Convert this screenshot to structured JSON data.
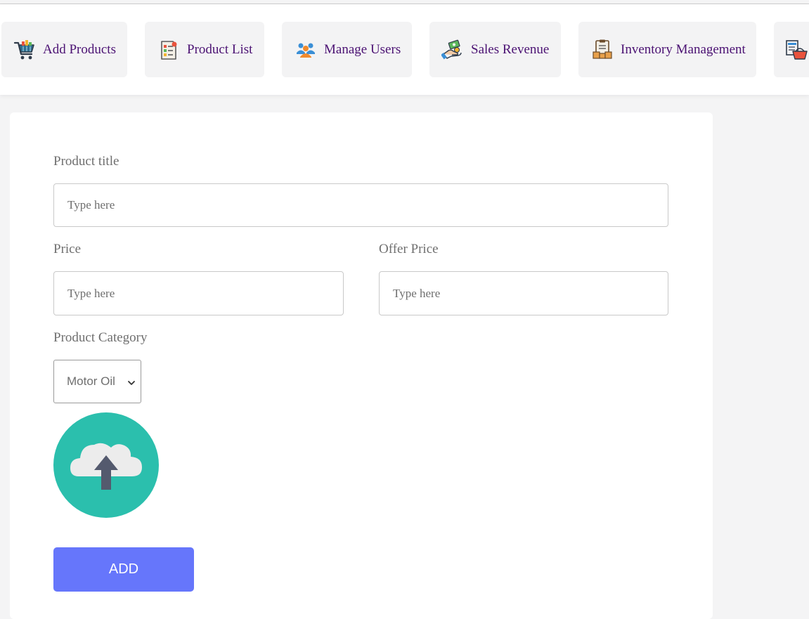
{
  "nav": {
    "items": [
      {
        "label": "Add Products",
        "icon": "shopping-cart-icon"
      },
      {
        "label": "Product List",
        "icon": "checklist-icon"
      },
      {
        "label": "Manage Users",
        "icon": "users-icon"
      },
      {
        "label": "Sales Revenue",
        "icon": "money-hand-icon"
      },
      {
        "label": "Inventory Management",
        "icon": "clipboard-boxes-icon"
      },
      {
        "label": "",
        "icon": "basket-list-icon"
      }
    ]
  },
  "form": {
    "title_label": "Product title",
    "title_placeholder": "Type here",
    "price_label": "Price",
    "price_placeholder": "Type here",
    "offer_label": "Offer Price",
    "offer_placeholder": "Type here",
    "category_label": "Product Category",
    "category_value": "Motor Oil",
    "upload_icon": "cloud-upload-icon",
    "add_label": "ADD"
  },
  "colors": {
    "nav_text": "#4b1273",
    "upload_circle": "#2bbfad",
    "add_button": "#6676fb"
  }
}
